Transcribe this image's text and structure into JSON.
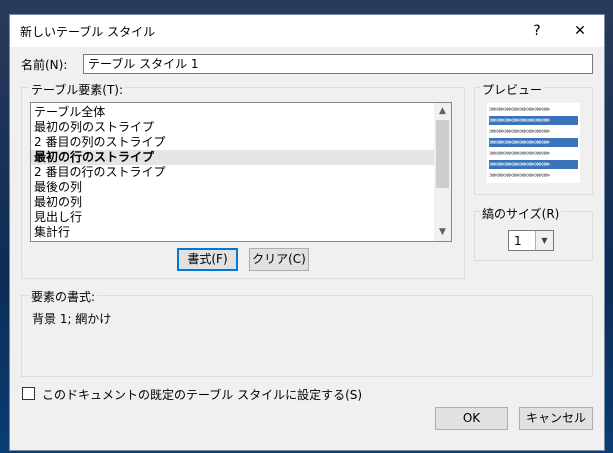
{
  "window": {
    "title": "新しいテーブル スタイル",
    "help_label": "?",
    "close_label": "✕"
  },
  "name_field": {
    "label": "名前(N):",
    "value": "テーブル スタイル 1"
  },
  "table_elements": {
    "label": "テーブル要素(T):",
    "items": [
      "テーブル全体",
      "最初の列のストライプ",
      "2 番目の列のストライプ",
      "最初の行のストライプ",
      "2 番目の行のストライプ",
      "最後の列",
      "最初の列",
      "見出し行",
      "集計行"
    ],
    "selected_index": 3
  },
  "buttons": {
    "format_label": "書式(F)",
    "clear_label": "クリア(C)",
    "ok_label": "OK",
    "cancel_label": "キャンセル"
  },
  "preview": {
    "label": "プレビュー",
    "row_text": "⋙⋙⋙⋙⋙⋙⋙⋙",
    "accent_color": "#3b73b9"
  },
  "stripe_size": {
    "label": "縞のサイズ(R)",
    "value": "1"
  },
  "element_format": {
    "label": "要素の書式:",
    "value": "背景 1; 網かけ"
  },
  "default_checkbox": {
    "label": "このドキュメントの既定のテーブル スタイルに設定する(S)",
    "checked": false
  }
}
